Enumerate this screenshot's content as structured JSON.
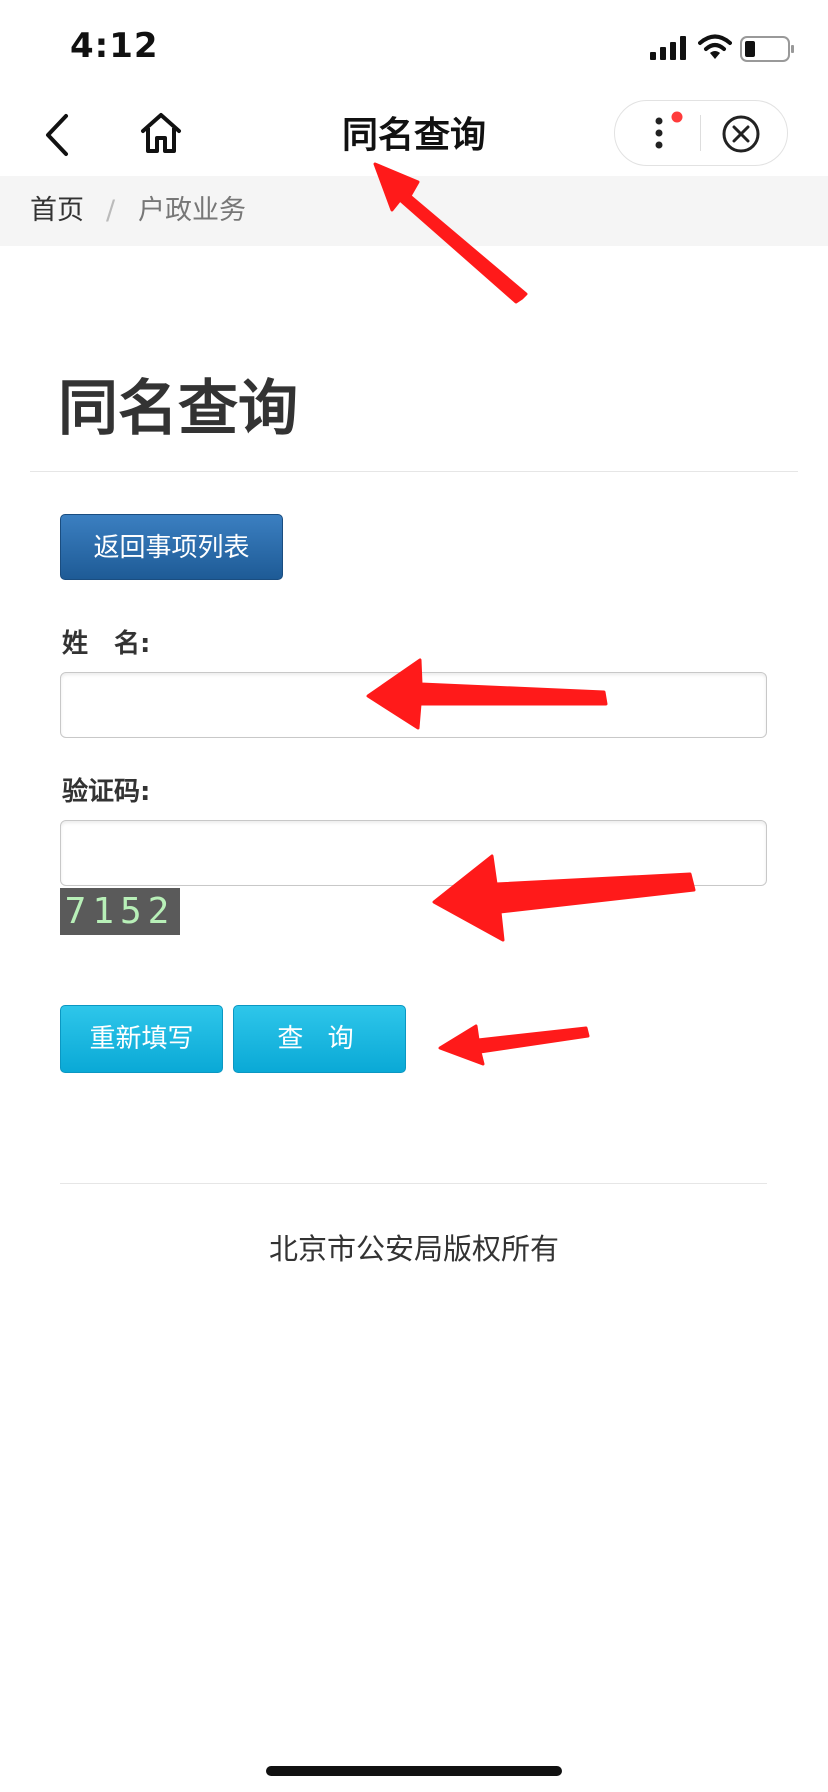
{
  "status_bar": {
    "time": "4:12"
  },
  "nav": {
    "title": "同名查询"
  },
  "breadcrumb": {
    "home": "首页",
    "separator": "/",
    "current": "户政业务"
  },
  "main": {
    "title": "同名查询",
    "back_button": "返回事项列表",
    "name_label": "姓　名:",
    "name_value": "",
    "captcha_label": "验证码:",
    "captcha_value": "",
    "captcha_code": "7152",
    "reset_button": "重新填写",
    "query_button": "查 询"
  },
  "footer": {
    "copyright": "北京市公安局版权所有"
  },
  "colors": {
    "primary_button": "#2a6aad",
    "cyan_button": "#1ab8e0",
    "annotation_arrow": "#ff1a1a"
  }
}
